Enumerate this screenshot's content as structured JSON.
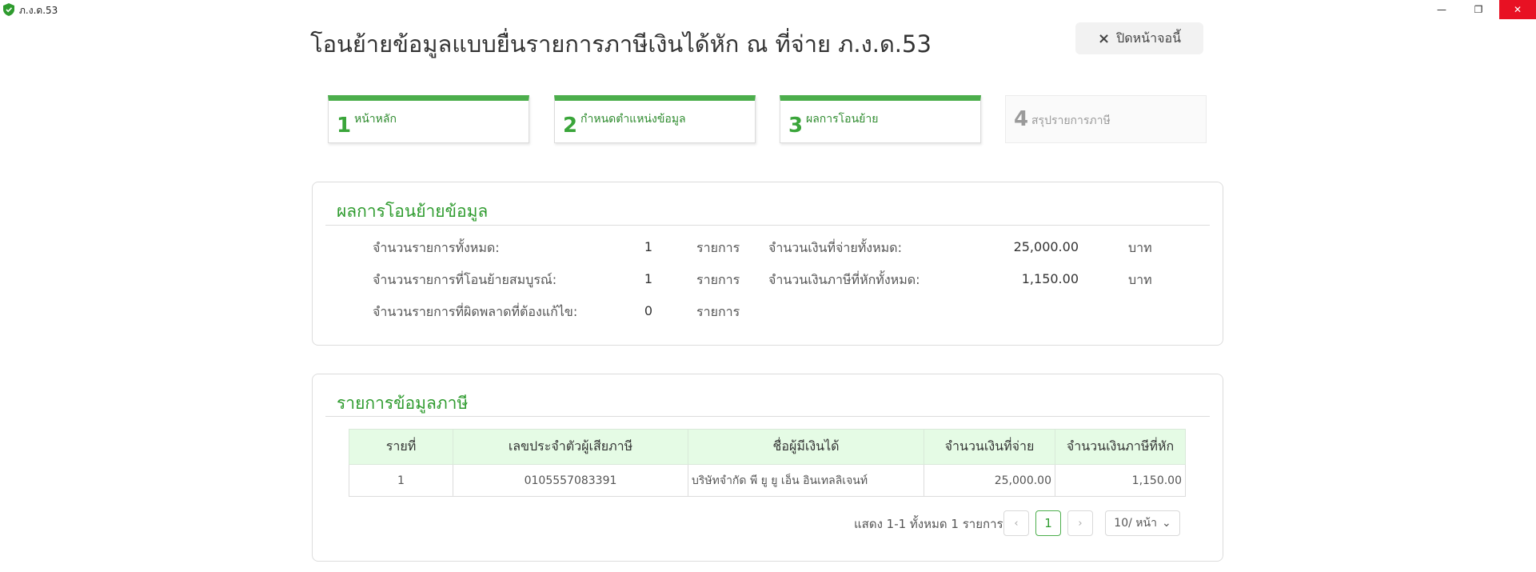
{
  "window": {
    "title": "ภ.ง.ด.53",
    "minimize_glyph": "—",
    "maximize_glyph": "❐",
    "close_glyph": "✕"
  },
  "page": {
    "title": "โอนย้ายข้อมูลแบบยื่นรายการภาษีเงินได้หัก ณ ที่จ่าย ภ.ง.ด.53",
    "close_button": "ปิดหน้าจอนี้",
    "close_icon": "×"
  },
  "steps": [
    {
      "num": "1",
      "label": "หน้าหลัก",
      "state": "done"
    },
    {
      "num": "2",
      "label": "กำหนดตำแหน่งข้อมูล",
      "state": "done"
    },
    {
      "num": "3",
      "label": "ผลการโอนย้าย",
      "state": "current"
    },
    {
      "num": "4",
      "label": "สรุปรายการภาษี",
      "state": "pending"
    }
  ],
  "summary": {
    "title": "ผลการโอนย้ายข้อมูล",
    "total_items_label": "จำนวนรายการทั้งหมด:",
    "total_items_value": "1",
    "complete_items_label": "จำนวนรายการที่โอนย้ายสมบูรณ์:",
    "complete_items_value": "1",
    "error_items_label": "จำนวนรายการที่ผิดพลาดที่ต้องแก้ไข:",
    "error_items_value": "0",
    "item_unit": "รายการ",
    "total_paid_label": "จำนวนเงินที่จ่ายทั้งหมด:",
    "total_paid_value": "25,000.00",
    "total_tax_label": "จำนวนเงินภาษีที่หักทั้งหมด:",
    "total_tax_value": "1,150.00",
    "money_unit": "บาท"
  },
  "tax_list": {
    "title": "รายการข้อมูลภาษี",
    "columns": [
      "รายที่",
      "เลขประจำตัวผู้เสียภาษี",
      "ชื่อผู้มีเงินได้",
      "จำนวนเงินที่จ่าย",
      "จำนวนเงินภาษีที่หัก"
    ],
    "rows": [
      {
        "no": "1",
        "tax_id": "0105557083391",
        "name": "บริษัทจำกัด พี ยู ยู เอ็น อินเทลลิเจนท์",
        "paid": "25,000.00",
        "tax": "1,150.00"
      }
    ]
  },
  "pagination": {
    "info": "แสดง 1-1 ทั้งหมด 1 รายการ",
    "prev": "‹",
    "current": "1",
    "next": "›",
    "page_size": "10/ หน้า",
    "page_size_caret": "⌄"
  },
  "colors": {
    "accent": "#4cae4c",
    "title_green": "#2e9b2e",
    "header_bg": "#e5fbe5",
    "close_red": "#e81123"
  }
}
